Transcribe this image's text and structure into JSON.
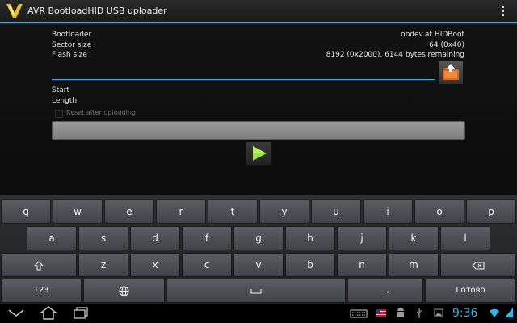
{
  "app": {
    "title": "AVR BootloadHID USB uploader"
  },
  "info": {
    "bootloader_label": "Bootloader",
    "bootloader_value": "obdev.at HIDBoot",
    "sector_label": "Sector size",
    "sector_value": "64 (0x40)",
    "flash_label": "Flash size",
    "flash_value": "8192 (0x2000), 6144 bytes remaining"
  },
  "file_input": {
    "value": ""
  },
  "fields": {
    "start_label": "Start",
    "length_label": "Length"
  },
  "reset_option": {
    "label": "Reset after uploading",
    "checked": false
  },
  "keyboard": {
    "row1": [
      "q",
      "w",
      "e",
      "r",
      "t",
      "y",
      "u",
      "i",
      "o",
      "p"
    ],
    "row2": [
      "a",
      "s",
      "d",
      "f",
      "g",
      "h",
      "j",
      "k",
      "l"
    ],
    "row3": [
      "z",
      "x",
      "c",
      "v",
      "b",
      "n",
      "m"
    ],
    "mode_label": "123",
    "punct_label": ". ,",
    "done_label": "Готово"
  },
  "statusbar": {
    "time": "9:36"
  },
  "colors": {
    "accent": "#33b5e5",
    "play": "#9be33d"
  }
}
